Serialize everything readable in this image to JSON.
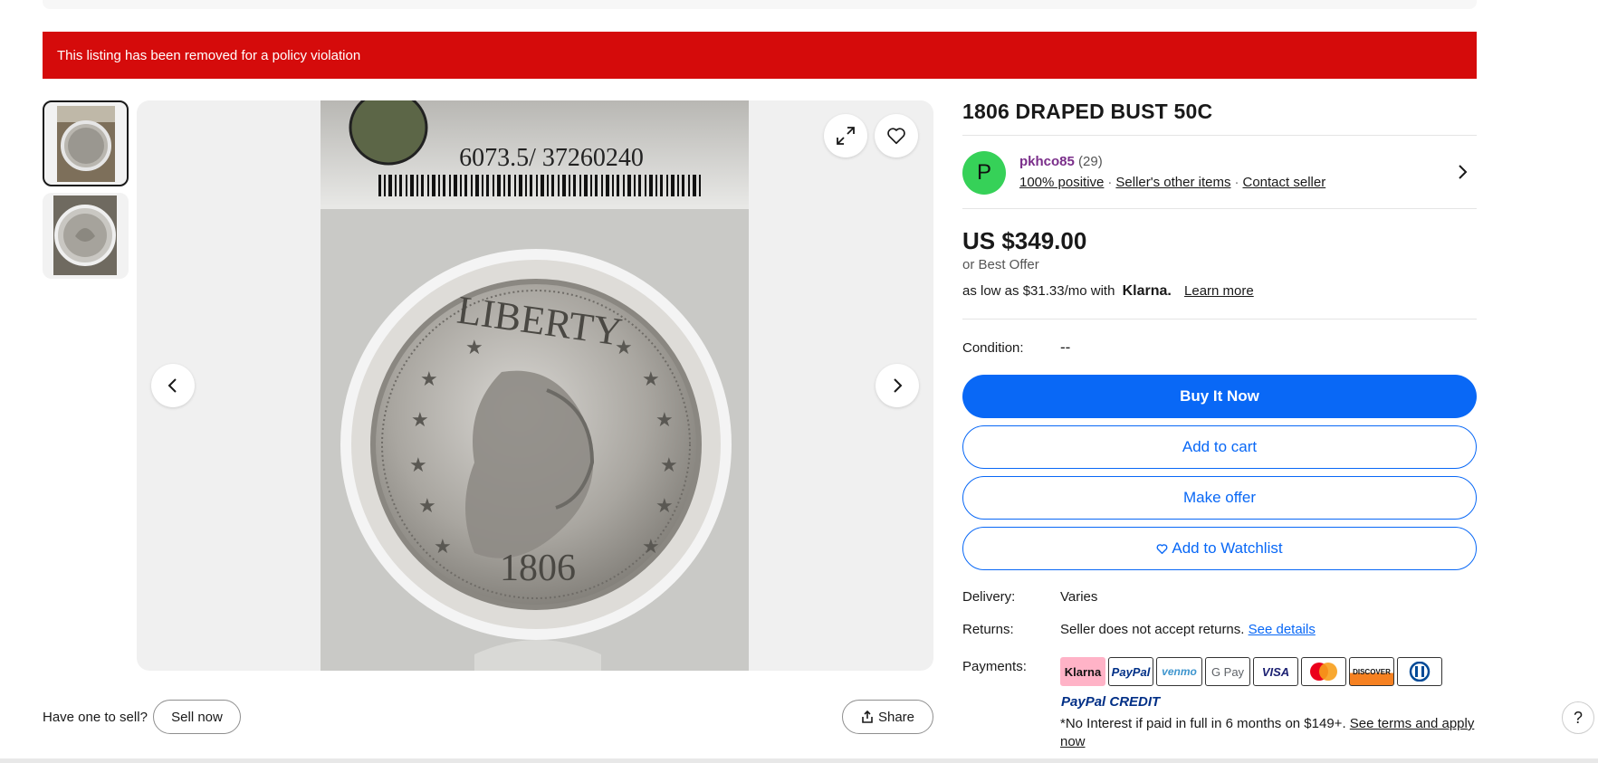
{
  "banner": {
    "text": "This listing has been removed for a policy violation"
  },
  "gallery": {
    "slab_text": "6073.5/  37260240",
    "coin_top": "LIBERTY",
    "coin_year": "1806",
    "thumb_count": 2
  },
  "listing": {
    "title": "1806 DRAPED BUST 50C",
    "seller": {
      "avatar_letter": "P",
      "name": "pkhco85",
      "count": "(29)",
      "positive": "100% positive",
      "other_items": "Seller's other items",
      "contact": "Contact seller"
    },
    "price": "US $349.00",
    "best_offer": "or Best Offer",
    "klarna": {
      "prefix": "as low as $31.33/mo with",
      "brand": "Klarna.",
      "learn_more": "Learn more"
    },
    "condition": {
      "label": "Condition:",
      "value": "--"
    },
    "buttons": {
      "buy_now": "Buy It Now",
      "add_to_cart": "Add to cart",
      "make_offer": "Make offer",
      "watchlist": "Add to Watchlist"
    },
    "delivery": {
      "label": "Delivery:",
      "value": "Varies"
    },
    "returns": {
      "label": "Returns:",
      "value": "Seller does not accept returns.",
      "link": "See details"
    },
    "payments": {
      "label": "Payments:",
      "methods": [
        "Klarna",
        "PayPal",
        "venmo",
        "G Pay",
        "VISA",
        "Mastercard",
        "DISCOVER",
        "Diners Club"
      ],
      "paypal_credit": "PayPal CREDIT",
      "no_interest": "*No Interest if paid in full in 6 months on $149+.",
      "terms_link": "See terms and apply now"
    }
  },
  "bottom": {
    "have_one": "Have one to sell?",
    "sell_now": "Sell now",
    "share": "Share",
    "help": "?"
  },
  "colors": {
    "banner": "#d50b0b",
    "accent": "#0968f6",
    "avatar": "#36d158",
    "seller_name": "#7a2e8a"
  }
}
